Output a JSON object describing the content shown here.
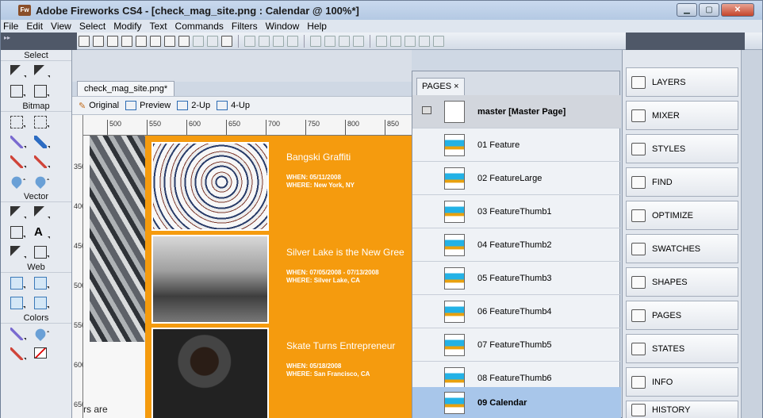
{
  "window": {
    "title": "Adobe Fireworks CS4 - [check_mag_site.png : Calendar @ 100%*]",
    "app_icon": "Fw",
    "controls": [
      "minimize",
      "maximize",
      "close"
    ]
  },
  "menu": [
    "File",
    "Edit",
    "View",
    "Select",
    "Modify",
    "Text",
    "Commands",
    "Filters",
    "Window",
    "Help"
  ],
  "tools": {
    "sections": [
      "Select",
      "Bitmap",
      "Vector",
      "Web",
      "Colors"
    ],
    "text_tool_glyph": "A"
  },
  "document": {
    "tab": "check_mag_site.png*",
    "views": [
      "Original",
      "Preview",
      "2-Up",
      "4-Up"
    ],
    "ruler_h": [
      "500",
      "550",
      "600",
      "650",
      "700",
      "750",
      "800",
      "850"
    ],
    "ruler_v": [
      "350",
      "400",
      "450",
      "500",
      "550",
      "600",
      "650"
    ],
    "partial_text": "rs are",
    "events": [
      {
        "title": "Bangski Graffiti",
        "when_label": "WHEN:",
        "when": "05/11/2008",
        "where_label": "WHERE:",
        "where": "New York, NY"
      },
      {
        "title": "Silver Lake is the New Gree",
        "when_label": "WHEN:",
        "when": "07/05/2008 - 07/13/2008",
        "where_label": "WHERE:",
        "where": "Silver Lake, CA"
      },
      {
        "title": "Skate Turns Entrepreneur",
        "when_label": "WHEN:",
        "when": "05/18/2008",
        "where_label": "WHERE:",
        "where": "San Francisco, CA"
      }
    ]
  },
  "pages_panel": {
    "tab": "PAGES",
    "close": "×",
    "pages": [
      {
        "label": "master [Master Page]",
        "type": "master"
      },
      {
        "label": "01 Feature"
      },
      {
        "label": "02 FeatureLarge"
      },
      {
        "label": "03 FeatureThumb1"
      },
      {
        "label": "04 FeatureThumb2"
      },
      {
        "label": "05 FeatureThumb3"
      },
      {
        "label": "06 FeatureThumb4"
      },
      {
        "label": "07 FeatureThumb5"
      },
      {
        "label": "08 FeatureThumb6"
      },
      {
        "label": "09 Calendar",
        "selected": true
      }
    ]
  },
  "dock": [
    "LAYERS",
    "MIXER",
    "STYLES",
    "FIND",
    "OPTIMIZE",
    "SWATCHES",
    "SHAPES",
    "PAGES",
    "STATES",
    "INFO",
    "HISTORY"
  ],
  "colors": {
    "orange": "#f59b0e",
    "selected_row": "#a8c6ea"
  }
}
